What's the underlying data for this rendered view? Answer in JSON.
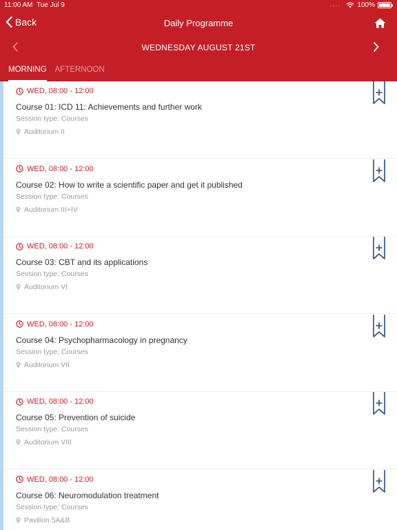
{
  "status_bar": {
    "time": "11:00 AM",
    "date": "Tue Jul 9",
    "battery": "100%"
  },
  "nav": {
    "back_label": "Back",
    "title": "Daily Programme"
  },
  "day": {
    "label": "WEDNESDAY AUGUST 21ST"
  },
  "tabs": [
    {
      "label": "MORNING",
      "active": true
    },
    {
      "label": "AFTERNOON",
      "active": false
    }
  ],
  "sessions": [
    {
      "time": "WED, 08:00 - 12:00",
      "title": "Course 01: ICD 11: Achievements and further work",
      "session_type": "Session type: Courses",
      "location": "Auditorium II"
    },
    {
      "time": "WED, 08:00 - 12:00",
      "title": "Course 02: How to write a scientific paper and get it published",
      "session_type": "Session type: Courses",
      "location": "Auditorium III+IV"
    },
    {
      "time": "WED, 08:00 - 12:00",
      "title": "Course 03: CBT and its applications",
      "session_type": "Session type: Courses",
      "location": "Auditorium VI"
    },
    {
      "time": "WED, 08:00 - 12:00",
      "title": "Course 04: Psychopharmacology in pregnancy",
      "session_type": "Session type: Courses",
      "location": "Auditorium VII"
    },
    {
      "time": "WED, 08:00 - 12:00",
      "title": "Course 05: Prevention of suicide",
      "session_type": "Session type: Courses",
      "location": "Auditorium VIII"
    },
    {
      "time": "WED, 08:00 - 12:00",
      "title": "Course 06: Neuromodulation treatment",
      "session_type": "Session type: Courses",
      "location": "Pavilion 5A&B"
    }
  ],
  "colors": {
    "brand_red": "#c41e26",
    "accent_blue": "#b7d6ef",
    "muted_text": "#9b9b9b"
  },
  "icons": {
    "back": "chevron-left-icon",
    "home": "home-icon",
    "prev_day": "chevron-left-icon",
    "next_day": "chevron-right-icon",
    "clock": "clock-icon",
    "location": "location-pin-icon",
    "bookmark": "bookmark-add-icon"
  }
}
